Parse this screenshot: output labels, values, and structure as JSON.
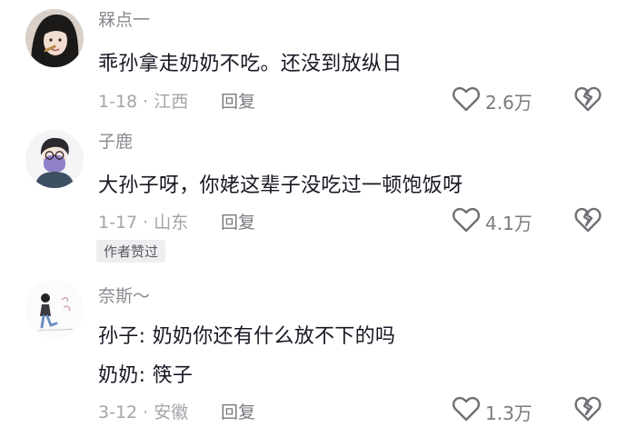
{
  "comments": [
    {
      "username": "槑点一",
      "lines": [
        "乖孙拿走奶奶不吃。还没到放纵日"
      ],
      "date": "1-18",
      "location": "江西",
      "reply_label": "回复",
      "likes": "2.6万",
      "avatar_icon": "avatar-girl-photo"
    },
    {
      "username": "子鹿",
      "lines": [
        "大孙子呀，你姥这辈子没吃过一顿饱饭呀"
      ],
      "date": "1-17",
      "location": "山东",
      "reply_label": "回复",
      "likes": "4.1万",
      "author_badge": "作者赞过",
      "avatar_icon": "avatar-cartoon-boy-mask"
    },
    {
      "username": "奈斯～",
      "lines": [
        "孙子: 奶奶你还有什么放不下的吗",
        "奶奶: 筷子"
      ],
      "date": "3-12",
      "location": "安徽",
      "reply_label": "回复",
      "likes": "1.3万",
      "avatar_icon": "avatar-cartoon-girl-sketch"
    }
  ],
  "colors": {
    "text_primary": "#161823",
    "text_secondary": "#8a8b91",
    "badge_bg": "#eeeef0"
  }
}
